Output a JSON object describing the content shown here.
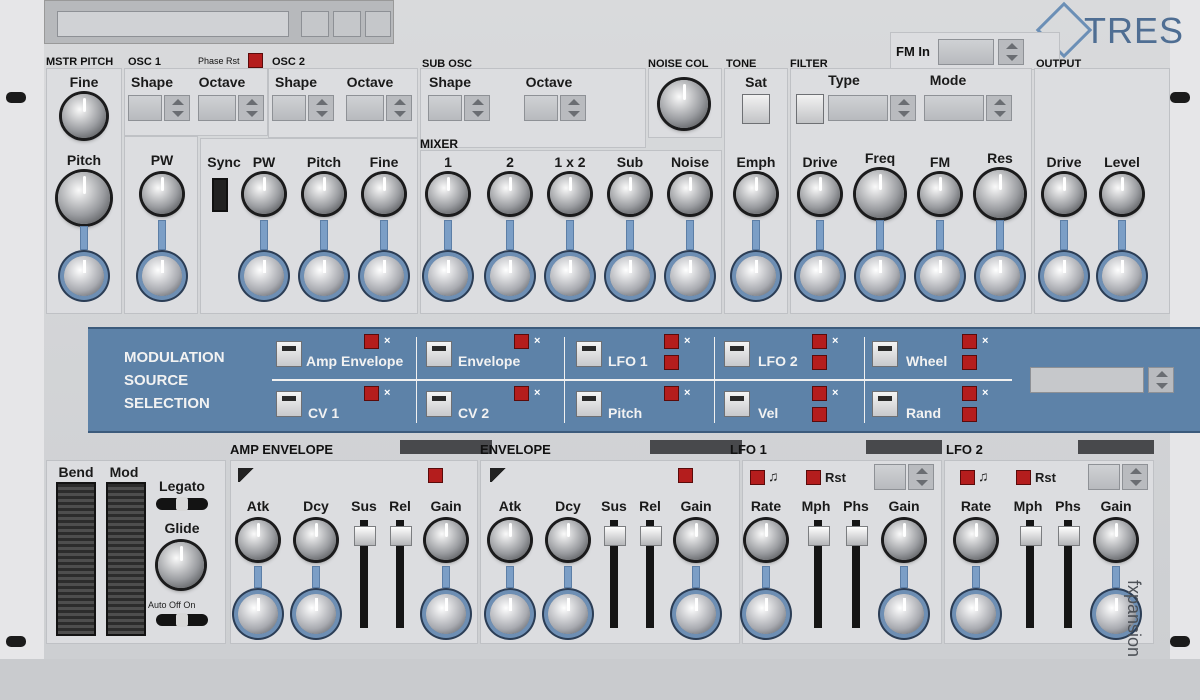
{
  "brand": {
    "logo": "TRES",
    "maker": "fxpansion"
  },
  "sections": {
    "mstr_pitch": "MSTR PITCH",
    "osc1": "OSC 1",
    "phase_rst": "Phase Rst",
    "osc2": "OSC 2",
    "sub_osc": "SUB OSC",
    "noise_col": "NOISE COL",
    "tone": "TONE",
    "filter": "FILTER",
    "output": "OUTPUT",
    "mixer": "MIXER",
    "amp_env": "AMP ENVELOPE",
    "env": "ENVELOPE",
    "lfo1": "LFO 1",
    "lfo2": "LFO 2"
  },
  "labels": {
    "fine": "Fine",
    "pitch": "Pitch",
    "shape": "Shape",
    "octave": "Octave",
    "pw": "PW",
    "sync": "Sync",
    "mix1": "1",
    "mix2": "2",
    "mix12": "1 x 2",
    "sub": "Sub",
    "noise": "Noise",
    "sat": "Sat",
    "emph": "Emph",
    "type": "Type",
    "mode": "Mode",
    "fm_in": "FM In",
    "drive": "Drive",
    "freq": "Freq",
    "fm": "FM",
    "res": "Res",
    "level": "Level",
    "bend": "Bend",
    "mod": "Mod",
    "legato": "Legato",
    "glide": "Glide",
    "auto_off_on": "Auto Off  On",
    "atk": "Atk",
    "dcy": "Dcy",
    "sus": "Sus",
    "rel": "Rel",
    "gain": "Gain",
    "rate": "Rate",
    "mph": "Mph",
    "phs": "Phs",
    "rst": "Rst"
  },
  "modulation": {
    "title": [
      "MODULATION",
      "SOURCE",
      "SELECTION"
    ],
    "sources": [
      "Amp Envelope",
      "Envelope",
      "LFO 1",
      "LFO 2",
      "Wheel",
      "CV 1",
      "CV 2",
      "Pitch",
      "Vel",
      "Rand"
    ]
  },
  "icons": {
    "mute": "×",
    "note": "♫"
  },
  "colors": {
    "accent": "#5d82a8",
    "led": "#b41d1d"
  }
}
